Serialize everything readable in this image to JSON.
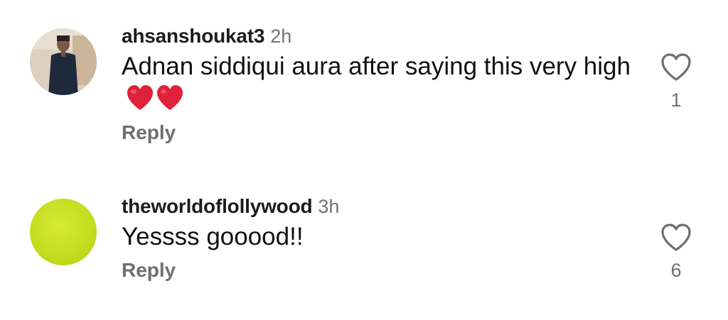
{
  "comments": [
    {
      "username": "ahsanshoukat3",
      "time": "2h",
      "text": "Adnan siddiqui aura after saying this very high",
      "emoji": [
        "red-heart",
        "red-heart"
      ],
      "reply_label": "Reply",
      "like_count": "1",
      "avatar": "profile-photo"
    },
    {
      "username": "theworldoflollywood",
      "time": "3h",
      "text": "Yessss gooood!!",
      "reply_label": "Reply",
      "like_count": "6",
      "avatar": "solid-lime-circle",
      "avatar_color": "#c4de20"
    }
  ],
  "colors": {
    "text": "#111111",
    "secondary": "#737373",
    "heart_emoji": "#e0213a"
  }
}
